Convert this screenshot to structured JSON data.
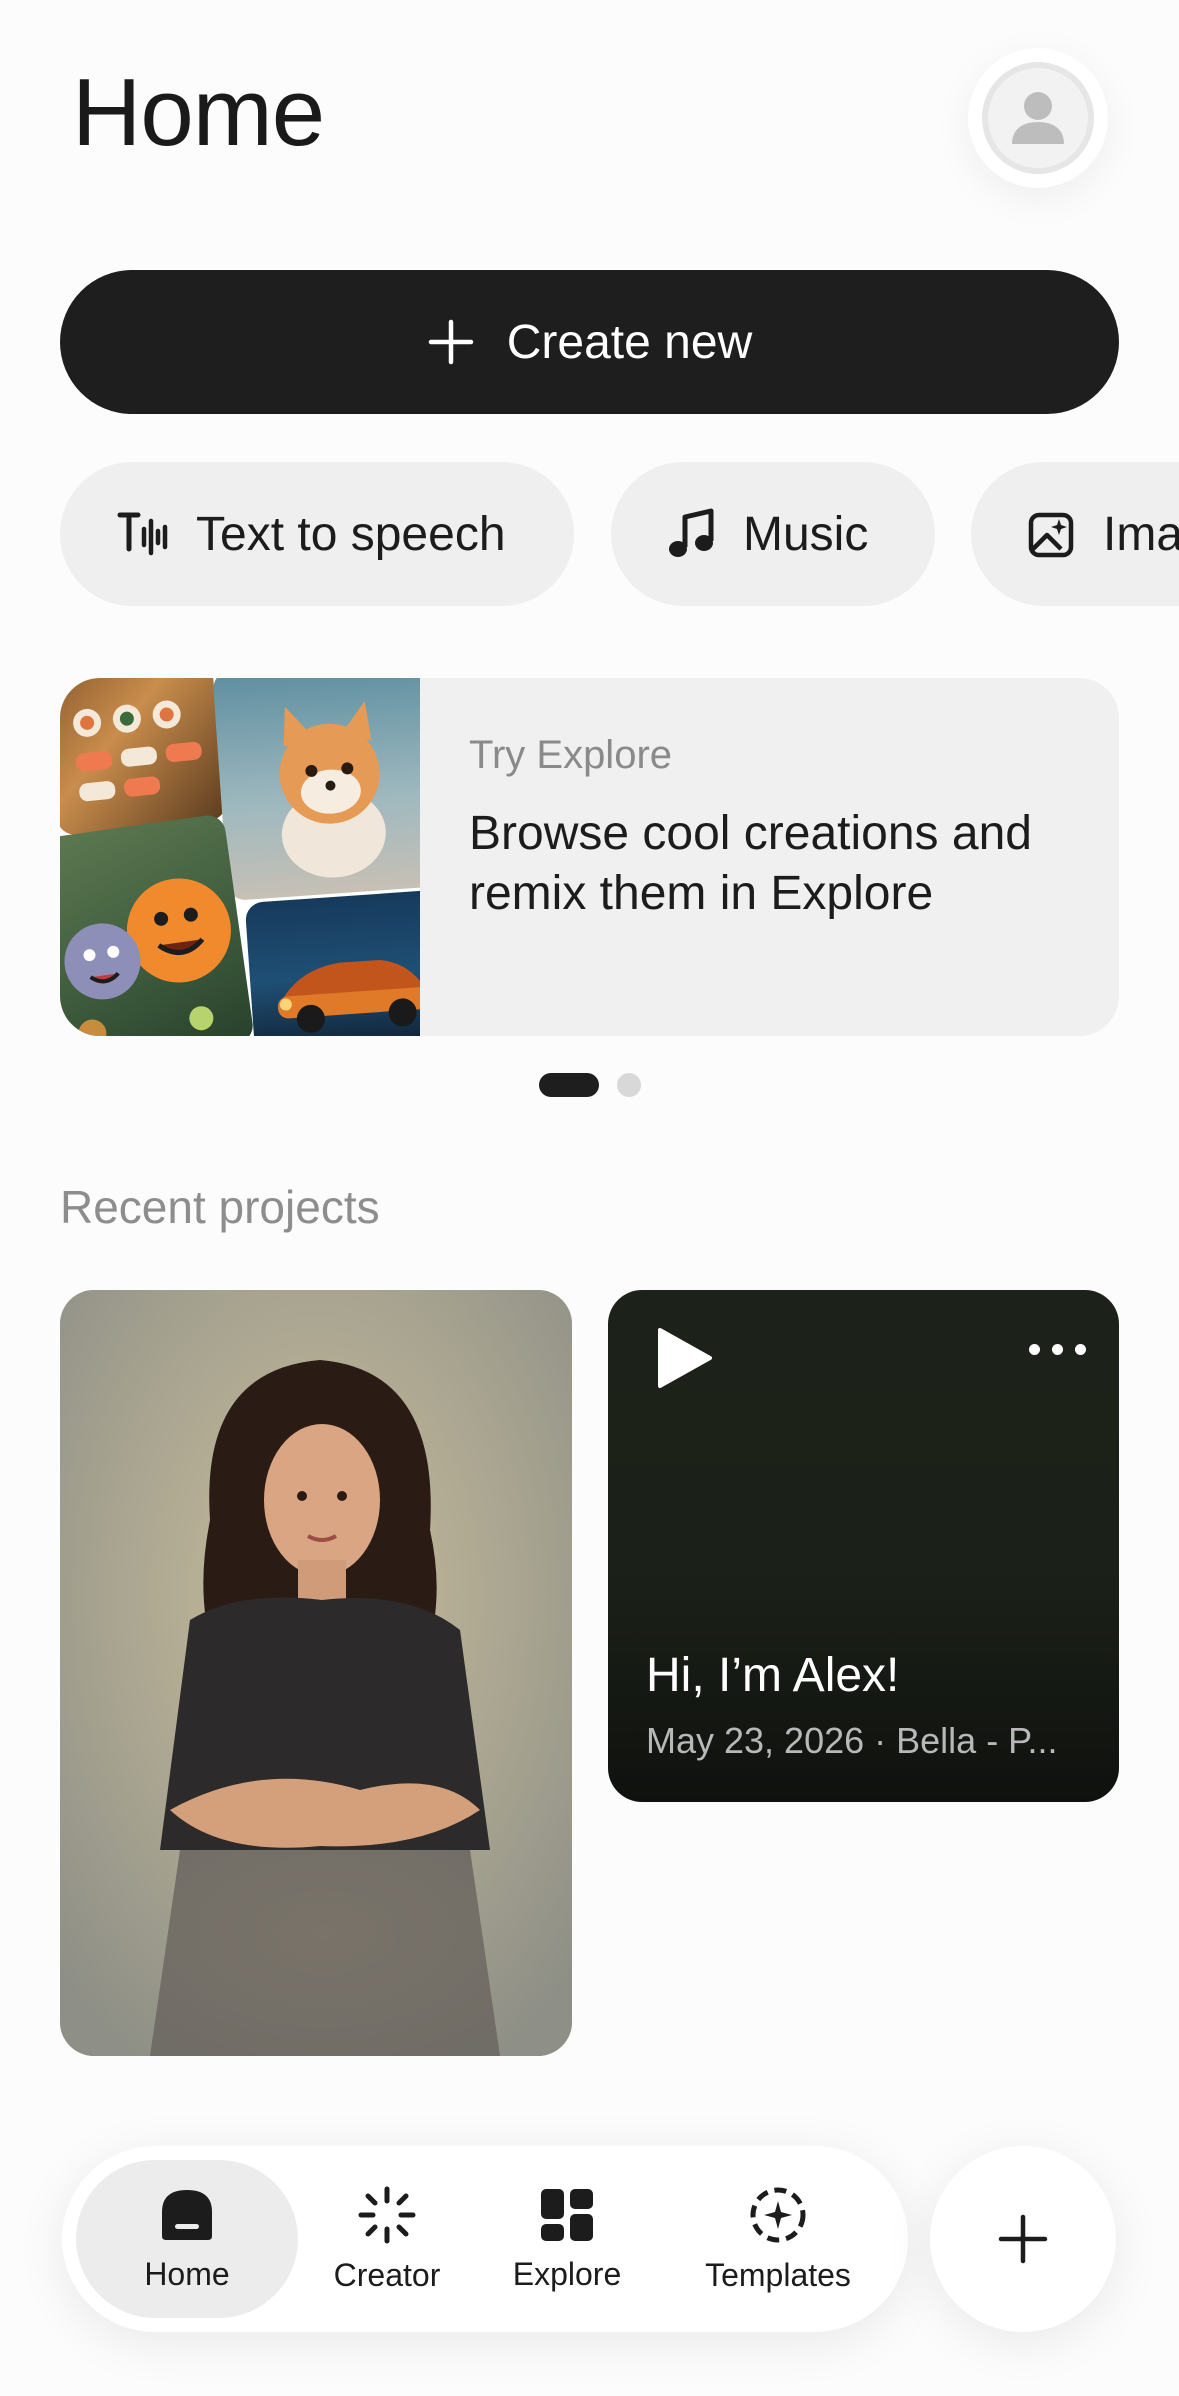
{
  "header": {
    "title": "Home",
    "avatar_icon": "user-avatar-icon"
  },
  "create_button": {
    "label": "Create new",
    "icon": "plus-icon"
  },
  "chips": [
    {
      "label": "Text to speech",
      "icon": "text-to-speech-icon"
    },
    {
      "label": "Music",
      "icon": "music-note-icon"
    },
    {
      "label": "Ima",
      "icon": "image-sparkle-icon"
    }
  ],
  "explore_card": {
    "kicker": "Try Explore",
    "title": "Browse cool creations and remix them in Explore"
  },
  "pager": {
    "total": 2,
    "active": 1
  },
  "recent": {
    "title": "Recent projects",
    "audio_card": {
      "title": "Hi, I’m Alex!",
      "meta": "May 23, 2026 · Bella - P..."
    }
  },
  "tabbar": {
    "tabs": [
      {
        "label": "Home",
        "icon": "home-icon",
        "active": true
      },
      {
        "label": "Creator",
        "icon": "creator-sparkle-icon",
        "active": false
      },
      {
        "label": "Explore",
        "icon": "explore-grid-icon",
        "active": false
      },
      {
        "label": "Templates",
        "icon": "templates-icon",
        "active": false
      }
    ],
    "fab_icon": "plus-icon"
  },
  "colors": {
    "accent_dark": "#1e1e1e",
    "chip_bg": "#efefef",
    "card_bg": "#f0f0f0",
    "muted_text": "#8d8d8d"
  }
}
